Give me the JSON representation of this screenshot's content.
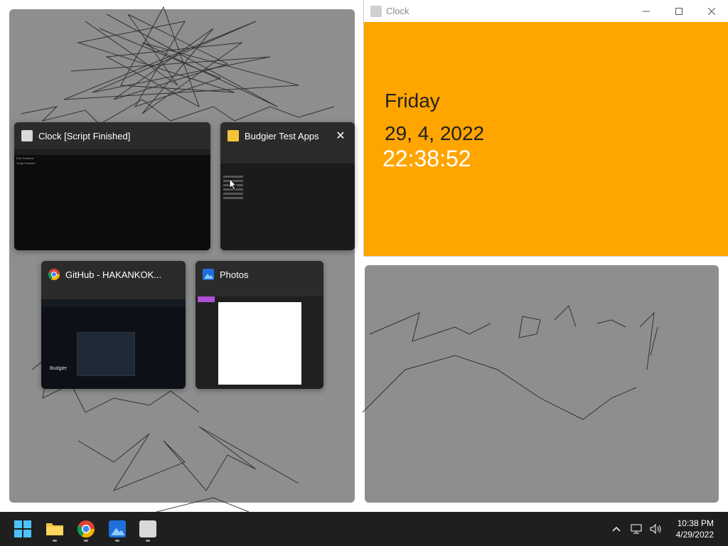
{
  "clock_window": {
    "title": "Clock",
    "day": "Friday",
    "date": "29, 4, 2022",
    "time": "22:38:52",
    "background_color": "#ffa500"
  },
  "task_view": {
    "thumbnails": [
      {
        "title": "Clock [Script Finished]",
        "icon": "clock-app-icon",
        "preview_lines": [
          "Exit: Finished",
          "Script Finished"
        ]
      },
      {
        "title": "Budgier Test Apps",
        "icon": "folder-icon",
        "close_label": "✕"
      },
      {
        "title": "GitHub - HAKANKOK...",
        "icon": "chrome-icon",
        "preview_heading": "Budgier"
      },
      {
        "title": "Photos",
        "icon": "photos-icon"
      }
    ]
  },
  "taskbar": {
    "apps": [
      {
        "name": "start-button",
        "icon": "windows-logo-icon"
      },
      {
        "name": "file-explorer",
        "icon": "folder-icon"
      },
      {
        "name": "chrome",
        "icon": "chrome-icon"
      },
      {
        "name": "photos",
        "icon": "photos-icon"
      },
      {
        "name": "clock-app",
        "icon": "clock-app-icon"
      }
    ],
    "tray": {
      "time": "10:38 PM",
      "date": "4/29/2022"
    }
  }
}
